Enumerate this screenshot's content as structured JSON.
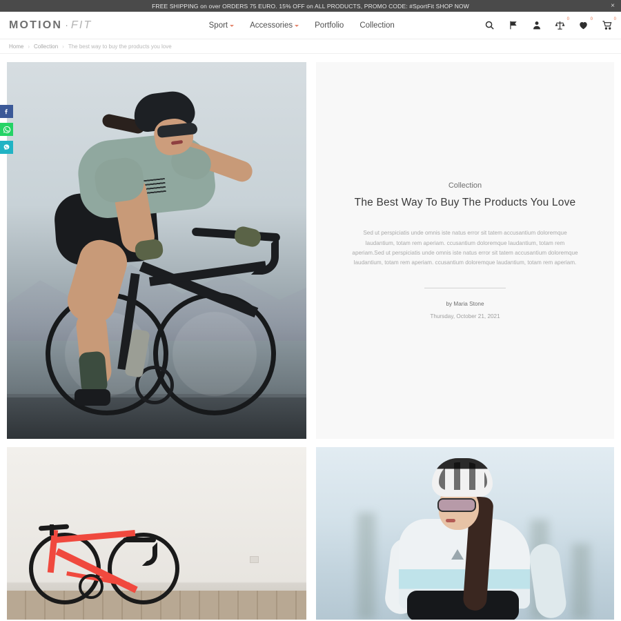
{
  "announcement": {
    "text": "FREE SHIPPING on over ORDERS 75 EURO. 15% OFF on ALL PRODUCTS, PROMO CODE: #SportFit SHOP NOW",
    "close_label": "×",
    "bg_color": "#4a4a4a"
  },
  "header": {
    "logo_main": "MOTION",
    "logo_dot": "·",
    "logo_sub": "FIT",
    "nav": [
      {
        "label": "Sport",
        "has_dropdown": true
      },
      {
        "label": "Accessories",
        "has_dropdown": true
      },
      {
        "label": "Portfolio",
        "has_dropdown": false
      },
      {
        "label": "Collection",
        "has_dropdown": false
      }
    ],
    "icons": [
      {
        "name": "search-icon",
        "badge": null
      },
      {
        "name": "flag-icon",
        "badge": null
      },
      {
        "name": "account-icon",
        "badge": null
      },
      {
        "name": "compare-icon",
        "badge": "0"
      },
      {
        "name": "wishlist-heart-icon",
        "badge": "0"
      },
      {
        "name": "cart-icon",
        "badge": "0"
      }
    ],
    "badge_color": "#e2714b"
  },
  "breadcrumb": {
    "separator": "›",
    "items": [
      "Home",
      "Collection",
      "The best way to buy the products you love"
    ]
  },
  "social_rail": [
    {
      "name": "facebook-share-button",
      "glyph": "f",
      "color": "#3b5998"
    },
    {
      "name": "whatsapp-share-button",
      "glyph": "whatsapp",
      "color": "#25d366"
    },
    {
      "name": "viber-share-button",
      "glyph": "viber",
      "color": "#21b3c4"
    }
  ],
  "article": {
    "category": "Collection",
    "title": "The Best Way To Buy The Products You Love",
    "body": "Sed ut perspiciatis unde omnis iste natus error sit tatem accusantium doloremque laudantium, totam rem aperiam. ccusantium doloremque laudantium, totam rem aperiam.Sed ut perspiciatis unde omnis iste natus error sit tatem accusantium doloremque laudantium, totam rem aperiam. ccusantium doloremque laudantium, totam rem aperiam.",
    "author": "by Maria Stone",
    "date": "Thursday, October 21, 2021"
  },
  "gallery": {
    "hero": {
      "name": "hero-photo-cyclist-green-jersey",
      "alt": "Female cyclist in sage green jersey riding a black road bike"
    },
    "bottom_left": {
      "name": "photo-red-road-bike",
      "alt": "Red road bike leaning against a white wall"
    },
    "bottom_right": {
      "name": "photo-cyclist-white-jersey",
      "alt": "Female cyclist in white and light blue jersey wearing helmet and sunglasses"
    }
  }
}
